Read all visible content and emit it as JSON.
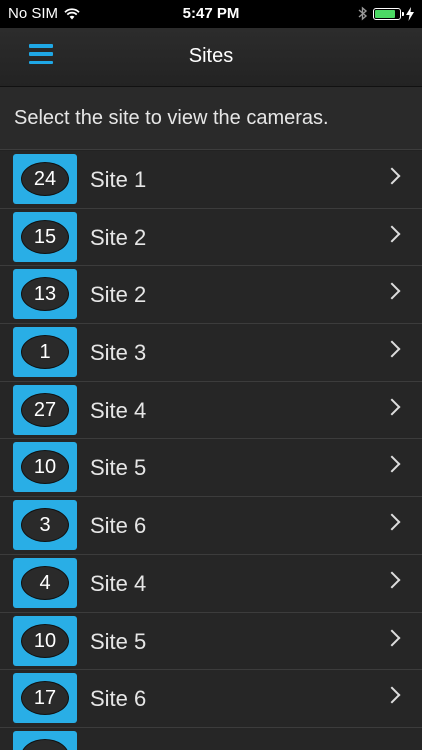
{
  "status_bar": {
    "carrier": "No SIM",
    "time": "5:47 PM",
    "battery_level": 0.85
  },
  "nav": {
    "title": "Sites"
  },
  "instruction": "Select the site to view the cameras.",
  "sites": [
    {
      "count": "24",
      "name": "Site 1"
    },
    {
      "count": "15",
      "name": "Site 2"
    },
    {
      "count": "13",
      "name": "Site 2"
    },
    {
      "count": "1",
      "name": "Site 3"
    },
    {
      "count": "27",
      "name": "Site 4"
    },
    {
      "count": "10",
      "name": "Site 5"
    },
    {
      "count": "3",
      "name": "Site 6"
    },
    {
      "count": "4",
      "name": "Site 4"
    },
    {
      "count": "10",
      "name": "Site 5"
    },
    {
      "count": "17",
      "name": "Site 6"
    }
  ],
  "colors": {
    "accent": "#29aee6",
    "battery": "#4cd964"
  }
}
